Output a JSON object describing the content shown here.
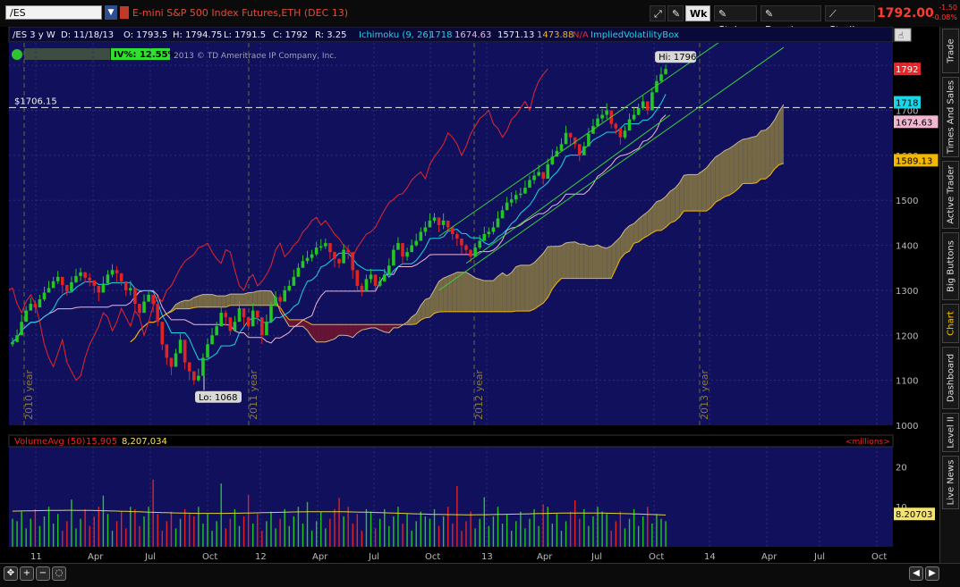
{
  "header": {
    "symbol": "/ES",
    "description": "E-mini S&P 500 Index Futures,ETH (DEC 13)",
    "wk_label": "Wk",
    "style_label": "Style",
    "drawings_label": "Drawings",
    "studies_label": "Studies",
    "last_price": "1792.00",
    "net_change": "-1.50",
    "pct_change": "-0.08%"
  },
  "info_bar": {
    "timeframe": "/ES 3 y W",
    "date": "D: 11/18/13",
    "open": "O: 1793.5",
    "high": "H: 1794.75",
    "low": "L: 1791.5",
    "close": "C: 1792",
    "range": "R: 3.25",
    "ichimoku_label": "Ichimoku (9, 26)",
    "ichimoku_values": [
      "1718",
      "1674.63",
      "1571.13",
      "1473.88",
      "N/A"
    ],
    "ivbox_label": "ImpliedVolatilityBox",
    "iv_label": "IV%: 12.55%",
    "copyright": "2013 © TD Ameritrade IP Company, Inc."
  },
  "volume_bar": {
    "label": "VolumeAvg (50)",
    "value1": "15,905",
    "value2": "8,207,034",
    "units": "<millions>"
  },
  "right_tabs": [
    "Trade",
    "Times And Sales",
    "Active Trader",
    "Big Buttons",
    "Chart",
    "Dashboard",
    "Level II",
    "Live News"
  ],
  "colors": {
    "panel_bg": "#10105c",
    "price_red": "#e8262a",
    "tenkan": "#19d6e8",
    "kijun": "#f2b6d2",
    "chikou": "#e8262a",
    "channel": "#3bcf3b",
    "cloud_bull": "#7a6e44",
    "cloud_bear": "#6a1630",
    "senkou_a": "#f5b800",
    "up_bar": "#23c623",
    "down_bar": "#e02424",
    "vol_avg": "#e0d43a"
  },
  "chart_data": [
    {
      "type": "candlestick",
      "title": "E-mini S&P 500 Index Futures,ETH (DEC 13)",
      "ylim": [
        1000,
        1850
      ],
      "y_ticks": [
        1000,
        1100,
        1200,
        1300,
        1400,
        1500,
        1600,
        1700,
        1800
      ],
      "grid": true,
      "x_ticks": [
        "11",
        "Apr",
        "Jul",
        "Oct",
        "12",
        "Apr",
        "Jul",
        "Oct",
        "13",
        "Apr",
        "Jul",
        "Oct",
        "14",
        "Apr",
        "Jul",
        "Oct"
      ],
      "year_markers": [
        "2010 year",
        "2011 year",
        "2012 year",
        "2013 year"
      ],
      "hline": {
        "label": "$1706.15",
        "value": 1706.15
      },
      "annotations": [
        {
          "label": "Hi: 1796",
          "value": 1796
        },
        {
          "label": "Lo: 1068",
          "value": 1068
        }
      ],
      "price_tags": [
        {
          "value": 1792,
          "label": "1792",
          "color": "#e8262a",
          "text_color": "#ffffff"
        },
        {
          "value": 1718,
          "label": "1718",
          "color": "#19d6e8",
          "text_color": "#000000"
        },
        {
          "value": 1674.63,
          "label": "1674.63",
          "color": "#f2b6d2",
          "text_color": "#000000"
        },
        {
          "value": 1589.13,
          "label": "1589.13",
          "color": "#f5b800",
          "text_color": "#000000"
        }
      ],
      "candles_weekly_close_approx": [
        1185,
        1200,
        1230,
        1255,
        1270,
        1262,
        1280,
        1295,
        1305,
        1320,
        1330,
        1312,
        1298,
        1318,
        1332,
        1340,
        1328,
        1322,
        1310,
        1295,
        1315,
        1335,
        1345,
        1338,
        1320,
        1300,
        1305,
        1270,
        1250,
        1275,
        1290,
        1270,
        1230,
        1180,
        1150,
        1130,
        1160,
        1190,
        1140,
        1120,
        1100,
        1110,
        1150,
        1180,
        1200,
        1220,
        1250,
        1240,
        1210,
        1230,
        1260,
        1240,
        1220,
        1255,
        1240,
        1200,
        1230,
        1265,
        1285,
        1275,
        1300,
        1310,
        1330,
        1350,
        1365,
        1372,
        1380,
        1395,
        1398,
        1405,
        1385,
        1370,
        1360,
        1390,
        1385,
        1345,
        1310,
        1300,
        1325,
        1335,
        1310,
        1320,
        1335,
        1355,
        1390,
        1405,
        1375,
        1385,
        1400,
        1410,
        1430,
        1440,
        1455,
        1462,
        1445,
        1455,
        1440,
        1425,
        1415,
        1400,
        1390,
        1375,
        1395,
        1410,
        1425,
        1430,
        1440,
        1460,
        1478,
        1495,
        1502,
        1512,
        1515,
        1528,
        1545,
        1555,
        1563,
        1548,
        1580,
        1597,
        1610,
        1625,
        1650,
        1640,
        1625,
        1600,
        1620,
        1648,
        1665,
        1682,
        1690,
        1700,
        1670,
        1660,
        1640,
        1655,
        1680,
        1690,
        1705,
        1720,
        1700,
        1740,
        1765,
        1780,
        1792
      ]
    },
    {
      "type": "bar",
      "title": "VolumeAvg (50)",
      "units": "millions",
      "ylim": [
        0,
        25
      ],
      "y_ticks": [
        10,
        20
      ],
      "avg_value": 8.20703,
      "avg_label": "8.20703"
    }
  ]
}
